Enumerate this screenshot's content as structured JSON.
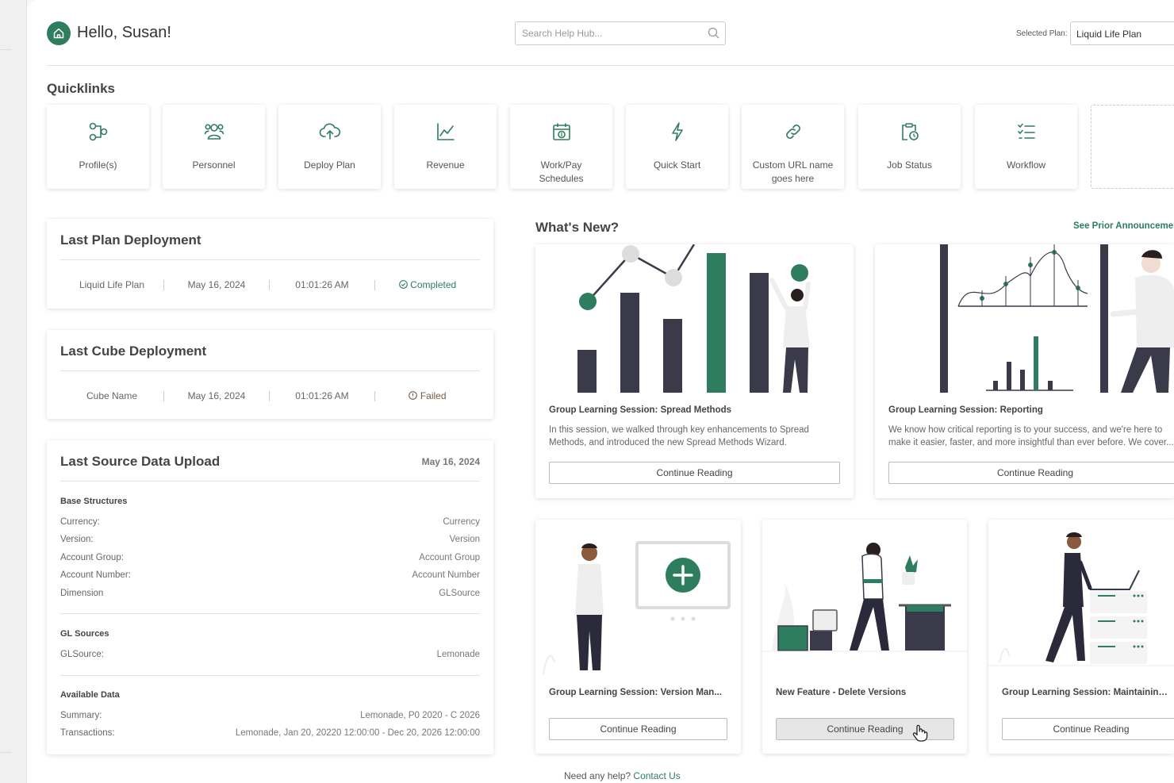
{
  "header": {
    "greeting": "Hello, Susan!",
    "search_placeholder": "Search Help Hub...",
    "plan_label": "Selected Plan:",
    "plan_value": "Liquid Life Plan"
  },
  "quicklinks": {
    "title": "Quicklinks",
    "items": [
      {
        "label": "Profile(s)",
        "icon": "profiles-icon"
      },
      {
        "label": "Personnel",
        "icon": "personnel-icon"
      },
      {
        "label": "Deploy Plan",
        "icon": "cloud-upload-icon"
      },
      {
        "label": "Revenue",
        "icon": "line-chart-icon"
      },
      {
        "label": "Work/Pay Schedules",
        "icon": "calendar-dollar-icon"
      },
      {
        "label": "Quick Start",
        "icon": "lightning-icon"
      },
      {
        "label": "Custom URL name goes here",
        "icon": "link-icon"
      },
      {
        "label": "Job Status",
        "icon": "clipboard-clock-icon"
      },
      {
        "label": "Workflow",
        "icon": "checklist-icon"
      }
    ]
  },
  "plan_deployment": {
    "title": "Last Plan Deployment",
    "name": "Liquid Life Plan",
    "date": "May 16, 2024",
    "time": "01:01:26 AM",
    "status": "Completed"
  },
  "cube_deployment": {
    "title": "Last Cube Deployment",
    "name": "Cube Name",
    "date": "May 16, 2024",
    "time": "01:01:26 AM",
    "status": "Failed"
  },
  "source_upload": {
    "title": "Last Source Data Upload",
    "date": "May 16, 2024",
    "base_title": "Base Structures",
    "base": [
      {
        "k": "Currency:",
        "v": "Currency"
      },
      {
        "k": "Version:",
        "v": "Version"
      },
      {
        "k": "Account Group:",
        "v": "Account Group"
      },
      {
        "k": "Account Number:",
        "v": "Account Number"
      },
      {
        "k": "Dimension",
        "v": "GLSource"
      }
    ],
    "gl_title": "GL Sources",
    "gl": [
      {
        "k": "GLSource:",
        "v": "Lemonade"
      }
    ],
    "avail_title": "Available Data",
    "avail": [
      {
        "k": "Summary:",
        "v": "Lemonade, P0 2020 - C 2026"
      },
      {
        "k": "Transactions:",
        "v": "Lemonade, Jan 20, 20220 12:00:00 - Dec 20, 2026 12:00:00"
      }
    ]
  },
  "whats_new": {
    "title": "What's New?",
    "see_prior": "See Prior Announcements",
    "cards": [
      {
        "title": "Group Learning Session: Spread Methods",
        "desc": "In this session, we walked through key enhancements to Spread Methods, and introduced the new Spread Methods Wizard.",
        "button": "Continue Reading"
      },
      {
        "title": "Group Learning Session: Reporting",
        "desc": "We know how critical reporting is to your success, and we're here to make it easier, faster, and more insightful than ever before. We cover...",
        "button": "Continue Reading"
      },
      {
        "title": "Group Learning Session: Version Man...",
        "button": "Continue Reading"
      },
      {
        "title": "New Feature - Delete Versions",
        "button": "Continue Reading"
      },
      {
        "title": "Group Learning Session: Maintaining...",
        "button": "Continue Reading"
      }
    ]
  },
  "footer": {
    "help_text": "Need any help?",
    "contact": "Contact Us"
  },
  "colors": {
    "accent": "#2e7d5e",
    "dark": "#3a3a4a"
  }
}
